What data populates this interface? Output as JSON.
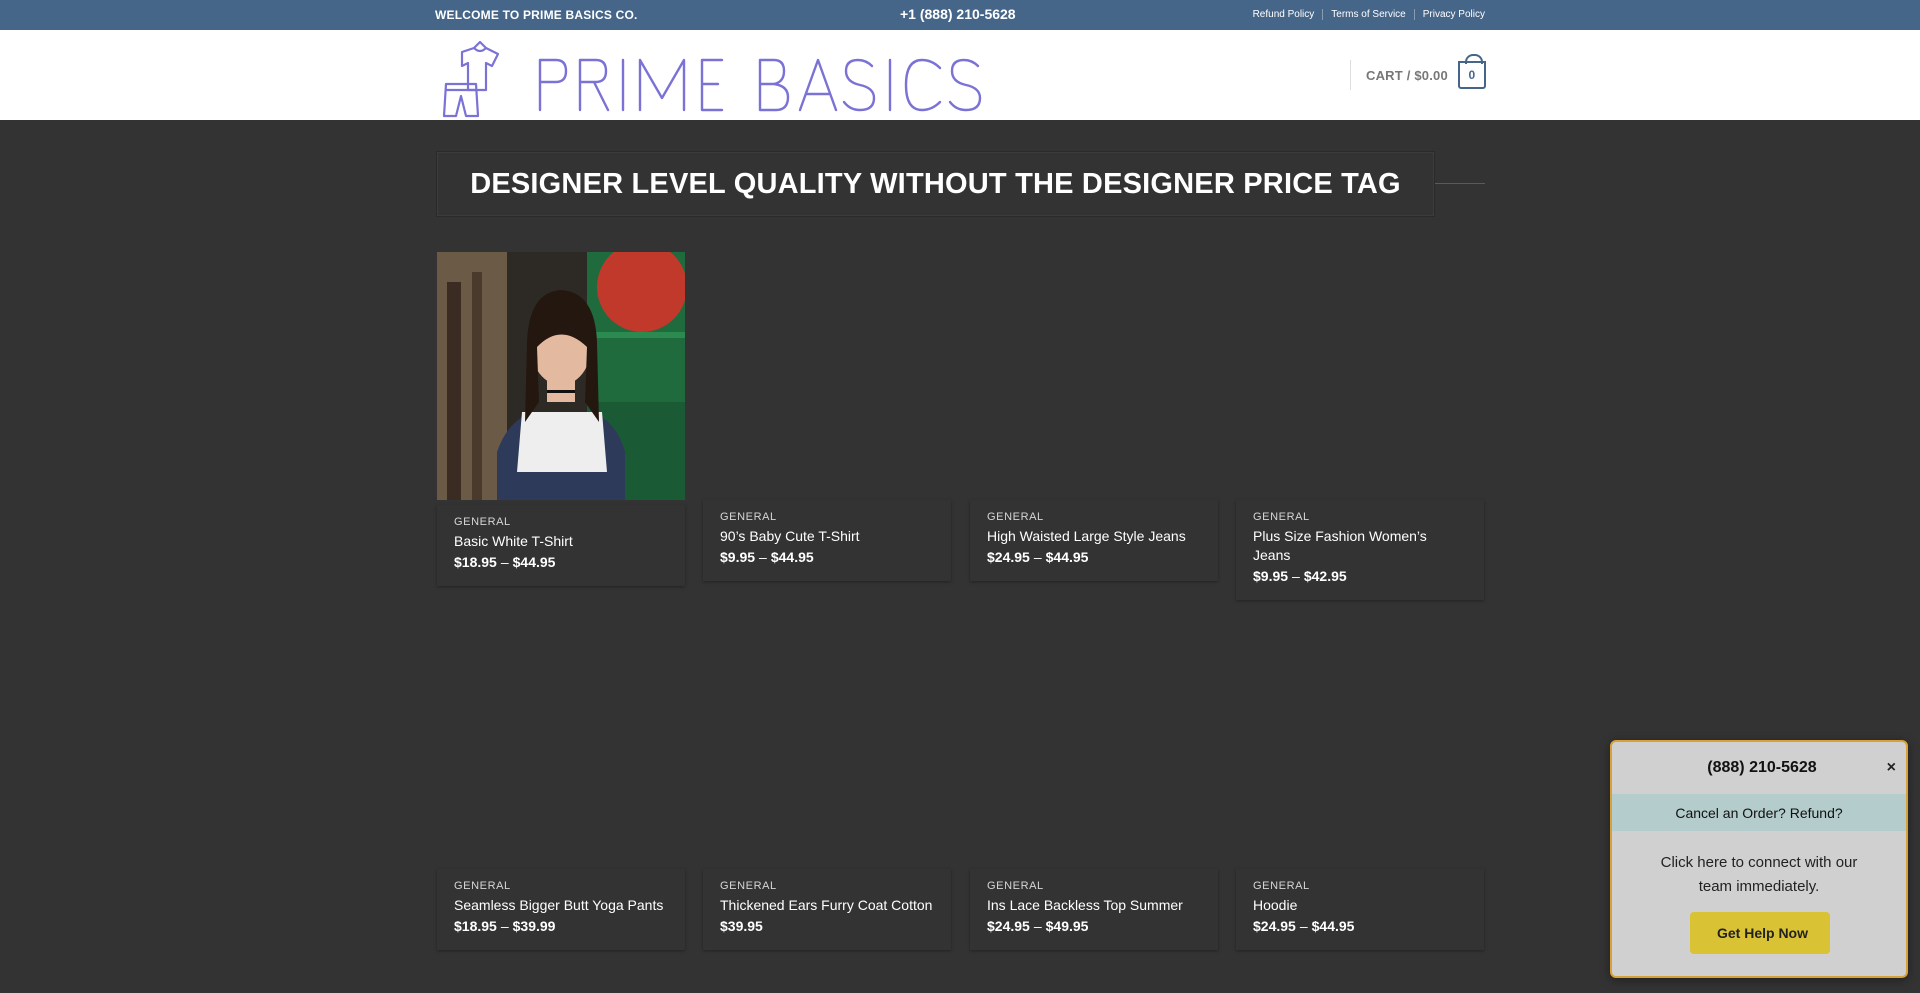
{
  "topbar": {
    "welcome": "WELCOME TO PRIME BASICS CO.",
    "phone": "+1 (888) 210-5628",
    "links": [
      "Refund Policy",
      "Terms of Service",
      "Privacy Policy"
    ]
  },
  "header": {
    "logo_text": "PRIME BASICS CO",
    "cart_label": "CART / $0.00",
    "cart_count": "0"
  },
  "banner": {
    "title": "DESIGNER LEVEL QUALITY WITHOUT THE DESIGNER PRICE TAG"
  },
  "products": [
    {
      "category": "GENERAL",
      "name": "Basic White T-Shirt",
      "price_low": "$18.95",
      "price_high": "$44.95"
    },
    {
      "category": "GENERAL",
      "name": "90’s Baby Cute T-Shirt",
      "price_low": "$9.95",
      "price_high": "$44.95"
    },
    {
      "category": "GENERAL",
      "name": "High Waisted Large Style Jeans",
      "price_low": "$24.95",
      "price_high": "$44.95"
    },
    {
      "category": "GENERAL",
      "name": "Plus Size Fashion Women’s Jeans",
      "price_low": "$9.95",
      "price_high": "$42.95"
    },
    {
      "category": "GENERAL",
      "name": "Seamless Bigger Butt Yoga Pants",
      "price_low": "$18.95",
      "price_high": "$39.99"
    },
    {
      "category": "GENERAL",
      "name": "Thickened Ears Furry Coat Cotton",
      "price_low": "$39.95",
      "price_high": ""
    },
    {
      "category": "GENERAL",
      "name": "Ins Lace Backless Top Summer",
      "price_low": "$24.95",
      "price_high": "$49.95"
    },
    {
      "category": "GENERAL",
      "name": "Hoodie",
      "price_low": "$24.95",
      "price_high": "$44.95"
    }
  ],
  "price_separator": "–",
  "popup": {
    "icon": "",
    "phone": "(888) 210-5628",
    "close": "×",
    "subtitle": "Cancel an Order? Refund?",
    "message": "Click here to connect with our team immediately.",
    "button_icon": "",
    "button_label": "Get Help Now"
  },
  "colors": {
    "topbar": "#466689",
    "background": "#333333",
    "logo": "#7b72d6",
    "popup_border": "#d8a038",
    "popup_button": "#d9c233"
  }
}
